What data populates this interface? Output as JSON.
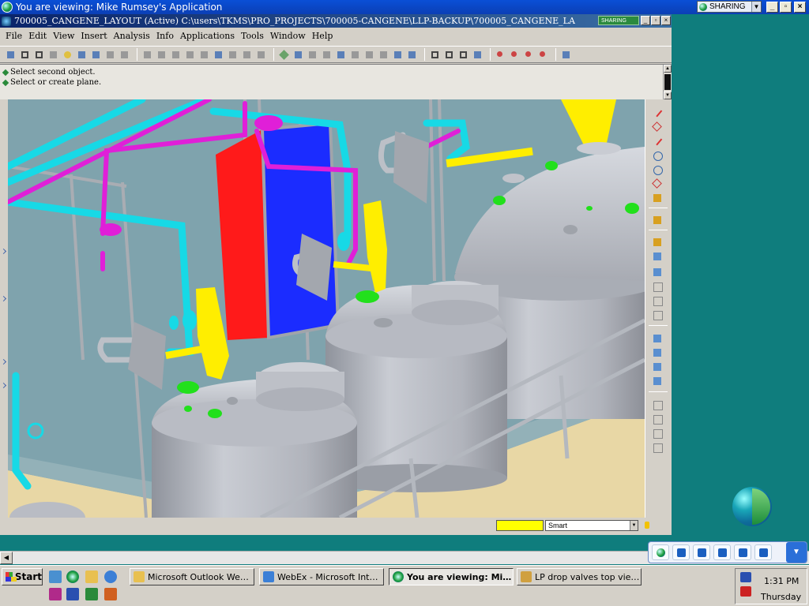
{
  "viewer": {
    "title": "You are viewing: Mike Rumsey's Application",
    "sharing_label": "SHARING"
  },
  "app": {
    "title": "700005_CANGENE_LAYOUT (Active) C:\\users\\TKMS\\PRO_PROJECTS\\700005-CANGENE\\LLP-BACKUP\\700005_CANGENE_LA",
    "mini_sharing": "SHARING",
    "menu": [
      "File",
      "Edit",
      "View",
      "Insert",
      "Analysis",
      "Info",
      "Applications",
      "Tools",
      "Window",
      "Help"
    ],
    "messages": [
      "Select second object.",
      "Select or create plane."
    ],
    "filter_value": "Smart"
  },
  "colors": {
    "sky": "#7fa3ad",
    "tank": "#b9bcc4",
    "cyan_pipe": "#17d9e6",
    "magenta_pipe": "#e01fd8",
    "yellow": "#ffee00",
    "red_panel": "#ff1a1a",
    "blue_panel": "#1b2cff",
    "green_nozzle": "#22e01c",
    "floor": "#e8d7a5"
  },
  "taskbar": {
    "start_label": "Start",
    "tasks": [
      {
        "label": "Microsoft Outlook Web A...",
        "icon": "outlook-icon"
      },
      {
        "label": "WebEx - Microsoft Inter...",
        "icon": "ie-icon"
      },
      {
        "label": "You are viewing: Mike...",
        "icon": "webex-icon"
      },
      {
        "label": "LP drop valves top view....",
        "icon": "paint-icon"
      }
    ],
    "clock": "1:31 PM",
    "day": "Thursday"
  }
}
